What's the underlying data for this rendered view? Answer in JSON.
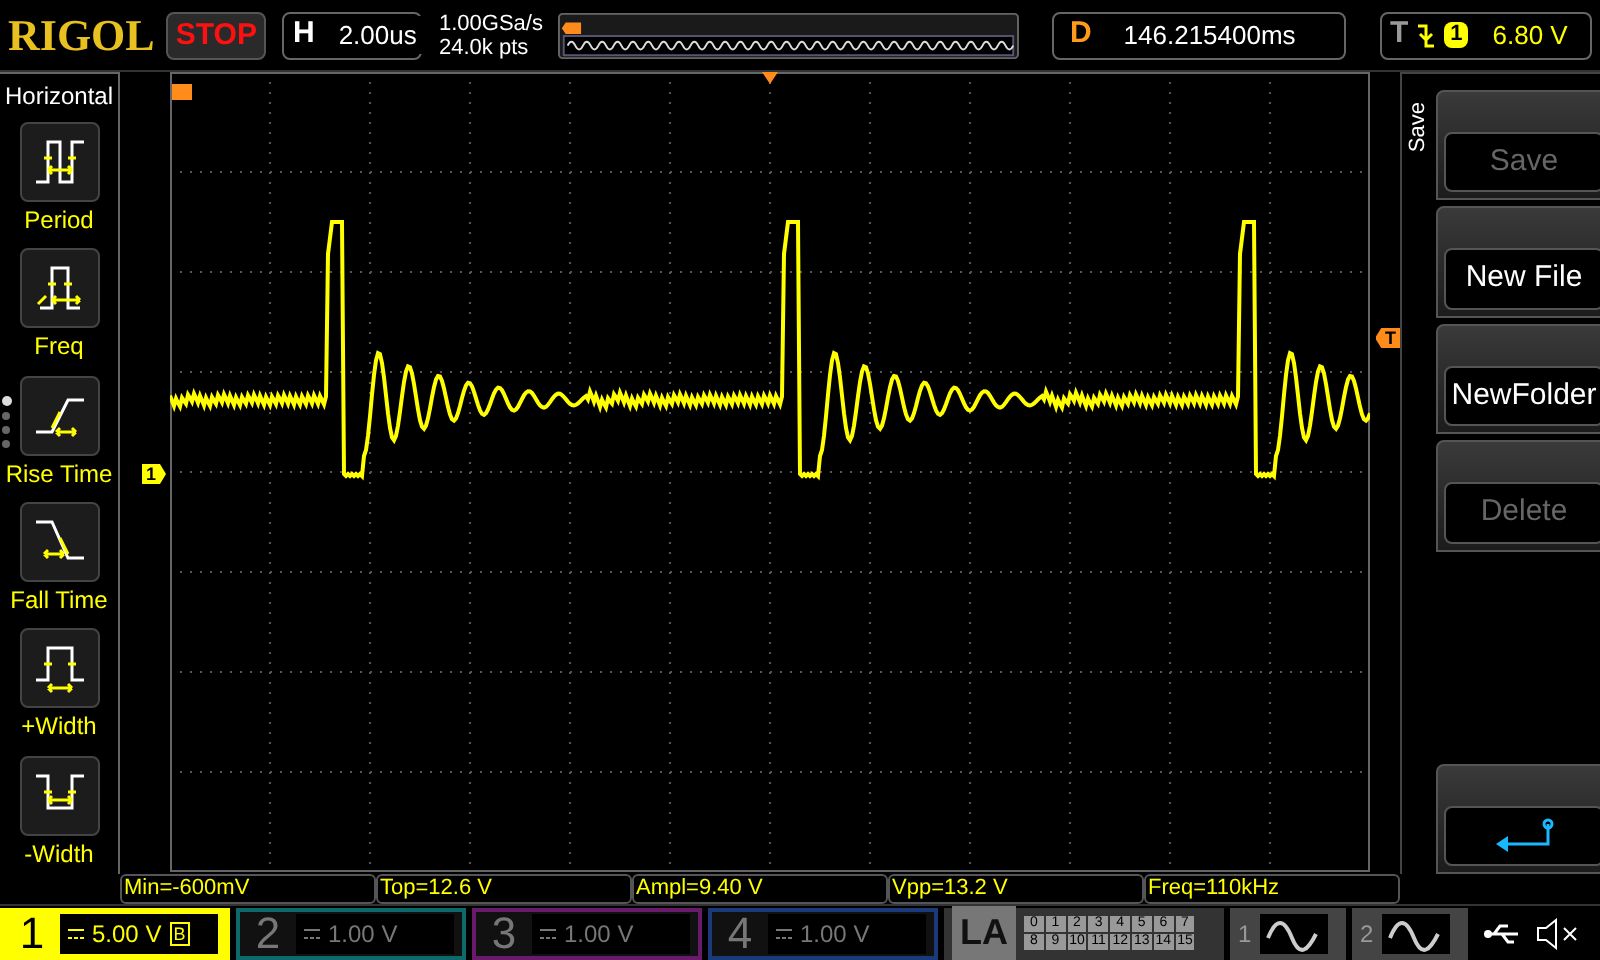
{
  "brand": "RIGOL",
  "run_state": "STOP",
  "timebase": {
    "label": "H",
    "value": "2.00us"
  },
  "acquisition": {
    "sample_rate": "1.00GSa/s",
    "memory_depth": "24.0k pts"
  },
  "delay": {
    "label": "D",
    "value": "146.215400ms"
  },
  "trigger": {
    "label": "T",
    "source": "1",
    "level": "6.80 V"
  },
  "measure_menu": {
    "title": "Horizontal",
    "items": [
      {
        "label": "Period",
        "kind": "period"
      },
      {
        "label": "Freq",
        "kind": "freq"
      },
      {
        "label": "Rise Time",
        "kind": "rise"
      },
      {
        "label": "Fall Time",
        "kind": "fall"
      },
      {
        "label": "+Width",
        "kind": "pwidth"
      },
      {
        "label": "-Width",
        "kind": "nwidth"
      }
    ],
    "pages": [
      {
        "selected": true
      },
      {
        "selected": false
      },
      {
        "selected": false
      },
      {
        "selected": false
      }
    ]
  },
  "markers": {
    "channel": "1",
    "trigger_level": "T"
  },
  "save_menu": {
    "title": "Save",
    "buttons": [
      {
        "kind": "text",
        "label": "Save",
        "disabled": true
      },
      {
        "kind": "text",
        "label": "New File",
        "disabled": false
      },
      {
        "kind": "text",
        "label": "NewFolder",
        "disabled": false
      },
      {
        "kind": "text",
        "label": "Delete",
        "disabled": true
      },
      {
        "kind": "back"
      }
    ]
  },
  "measurements": [
    "Min=-600mV",
    "Top=12.6 V",
    "Ampl=9.40 V",
    "Vpp=13.2 V",
    "Freq=110kHz"
  ],
  "channels": [
    {
      "number": "1",
      "scale": "5.00 V",
      "on": true,
      "badge": "B",
      "color": "#ffff00"
    },
    {
      "number": "2",
      "scale": "1.00 V",
      "on": false,
      "color": "#0e6a6a"
    },
    {
      "number": "3",
      "scale": "1.00 V",
      "on": false,
      "color": "#6a1a6a"
    },
    {
      "number": "4",
      "scale": "1.00 V",
      "on": false,
      "color": "#1a3a7a"
    }
  ],
  "la": {
    "label": "LA",
    "bits": [
      "0",
      "1",
      "2",
      "3",
      "4",
      "5",
      "6",
      "7",
      "8",
      "9",
      "10",
      "11",
      "12",
      "13",
      "14",
      "15"
    ]
  },
  "generators": [
    "1",
    "2"
  ]
}
